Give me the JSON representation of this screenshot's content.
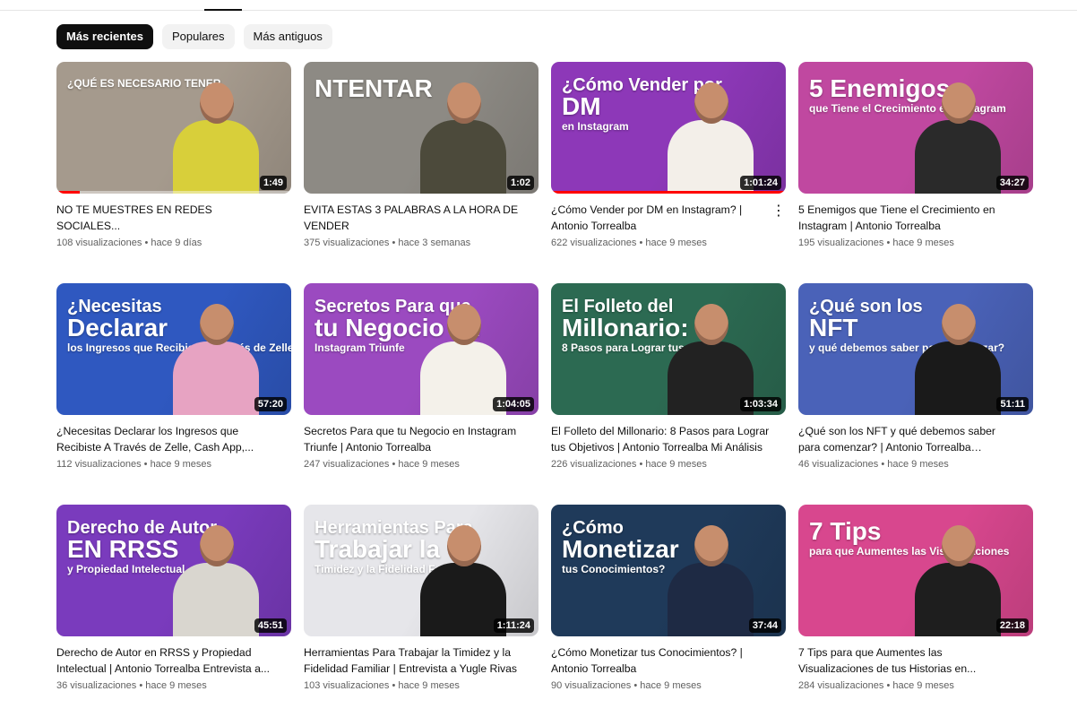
{
  "filters": [
    {
      "label": "Más recientes",
      "active": true
    },
    {
      "label": "Populares",
      "active": false
    },
    {
      "label": "Más antiguos",
      "active": false
    }
  ],
  "videos": [
    {
      "title": "NO TE MUESTRES EN REDES SOCIALES...",
      "views": "108 visualizaciones",
      "age": "hace 9 días",
      "duration": "1:49",
      "watched": 0.1,
      "thumb": {
        "bg": "#a59a8d",
        "shirt": "#d8cf3a",
        "lines": [
          "",
          "",
          "¿QUÉ ES NECESARIO TENER"
        ]
      }
    },
    {
      "title": "EVITA ESTAS 3 PALABRAS A LA HORA DE VENDER",
      "views": "375 visualizaciones",
      "age": "hace 3 semanas",
      "duration": "1:02",
      "thumb": {
        "bg": "#8d8a84",
        "shirt": "#4c4a3b",
        "lines": [
          "",
          "NTENTAR",
          ""
        ]
      }
    },
    {
      "title": "¿Cómo Vender por DM en Instagram? | Antonio Torrealba",
      "views": "622 visualizaciones",
      "age": "hace 9 meses",
      "duration": "1:01:24",
      "watched": 1.0,
      "menu": true,
      "thumb": {
        "bg": "#8d38b8",
        "shirt": "#f3efe9",
        "lines": [
          "¿Cómo Vender por",
          "DM",
          "en Instagram"
        ]
      }
    },
    {
      "title": "5 Enemigos que Tiene el Crecimiento en Instagram | Antonio Torrealba",
      "views": "195 visualizaciones",
      "age": "hace 9 meses",
      "duration": "34:27",
      "thumb": {
        "bg": "#c048a0",
        "shirt": "#2a2a2a",
        "lines": [
          "",
          "5 Enemigos",
          "que Tiene el Crecimiento en Instagram"
        ]
      }
    },
    {
      "title": "¿Necesitas Declarar los Ingresos que Recibiste A Través de Zelle, Cash App,...",
      "views": "112 visualizaciones",
      "age": "hace 9 meses",
      "duration": "57:20",
      "thumb": {
        "bg": "#2f58c0",
        "shirt": "#e7a3c2",
        "lines": [
          "¿Necesitas",
          "Declarar",
          "los Ingresos que Recibiste A Través de Zelle"
        ]
      }
    },
    {
      "title": "Secretos Para que tu Negocio en Instagram Triunfe | Antonio Torrealba",
      "views": "247 visualizaciones",
      "age": "hace 9 meses",
      "duration": "1:04:05",
      "thumb": {
        "bg": "#9b4ac0",
        "shirt": "#f4f1ea",
        "lines": [
          "Secretos Para que",
          "tu Negocio en",
          "Instagram Triunfe"
        ]
      }
    },
    {
      "title": "El Folleto del Millonario: 8 Pasos para Lograr tus Objetivos | Antonio Torrealba Mi Análisis",
      "views": "226 visualizaciones",
      "age": "hace 9 meses",
      "duration": "1:03:34",
      "thumb": {
        "bg": "#2c6a52",
        "shirt": "#222222",
        "lines": [
          "El Folleto del",
          "Millonario:",
          "8 Pasos para Lograr tus Objetivos"
        ]
      }
    },
    {
      "title": "¿Qué son los NFT y qué debemos saber para comenzar? | Antonio Torrealba Entrevista a...",
      "views": "46 visualizaciones",
      "age": "hace 9 meses",
      "duration": "51:11",
      "thumb": {
        "bg": "#4a62b8",
        "shirt": "#1a1a1a",
        "lines": [
          "¿Qué son los",
          "NFT",
          "y qué debemos saber para comenzar?"
        ]
      }
    },
    {
      "title": "Derecho de Autor en RRSS y Propiedad Intelectual | Antonio Torrealba Entrevista a...",
      "views": "36 visualizaciones",
      "age": "hace 9 meses",
      "duration": "45:51",
      "thumb": {
        "bg": "#7a3bbd",
        "shirt": "#d9d6cf",
        "lines": [
          "Derecho de Autor",
          "EN RRSS",
          "y Propiedad Intelectual"
        ]
      }
    },
    {
      "title": "Herramientas Para Trabajar la Timidez y la Fidelidad Familiar | Entrevista a Yugle Rivas",
      "views": "103 visualizaciones",
      "age": "hace 9 meses",
      "duration": "1:11:24",
      "thumb": {
        "bg": "#e6e6ea",
        "shirt": "#1a1a1a",
        "lines": [
          "Herramientas Para",
          "Trabajar la",
          "Timidez y la Fidelidad Familiar"
        ]
      }
    },
    {
      "title": "¿Cómo Monetizar tus Conocimientos? | Antonio Torrealba",
      "views": "90 visualizaciones",
      "age": "hace 9 meses",
      "duration": "37:44",
      "thumb": {
        "bg": "#1f3a5a",
        "shirt": "#1e2a44",
        "lines": [
          "¿Cómo",
          "Monetizar",
          "tus Conocimientos?"
        ]
      }
    },
    {
      "title": "7 Tips para que Aumentes las Visualizaciones de tus Historias en...",
      "views": "284 visualizaciones",
      "age": "hace 9 meses",
      "duration": "22:18",
      "thumb": {
        "bg": "#d8478e",
        "shirt": "#1e1e1e",
        "lines": [
          "",
          "7 Tips",
          "para que Aumentes las Visualizaciones"
        ]
      }
    }
  ]
}
